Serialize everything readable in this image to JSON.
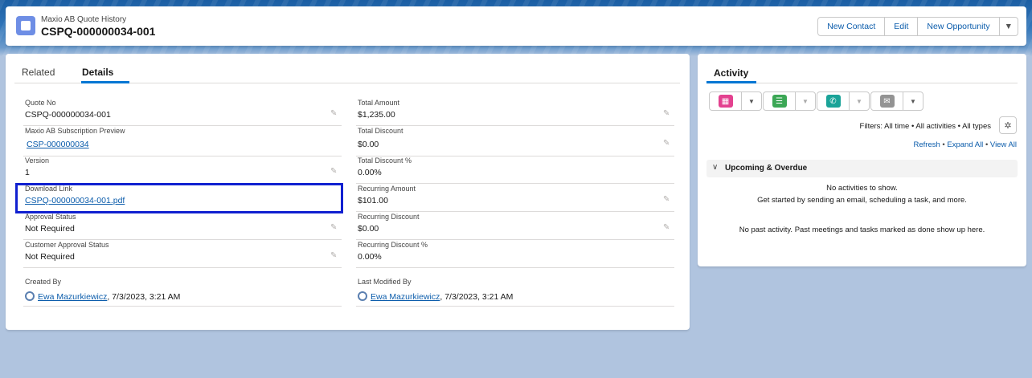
{
  "header": {
    "object_type": "Maxio AB Quote History",
    "record_title": "CSPQ-000000034-001",
    "buttons": [
      "New Contact",
      "Edit",
      "New Opportunity"
    ]
  },
  "tabs": [
    "Related",
    "Details"
  ],
  "details": {
    "left": [
      {
        "label": "Quote No",
        "value": "CSPQ-000000034-001"
      },
      {
        "label": "Maxio AB Subscription Preview",
        "value": "CSP-000000034"
      },
      {
        "label": "Version",
        "value": "1"
      },
      {
        "label": "Download Link",
        "value": "CSPQ-000000034-001.pdf"
      },
      {
        "label": "Approval Status",
        "value": "Not Required"
      },
      {
        "label": "Customer Approval Status",
        "value": "Not Required"
      }
    ],
    "right": [
      {
        "label": "Total Amount",
        "value": "$1,235.00"
      },
      {
        "label": "Total Discount",
        "value": "$0.00"
      },
      {
        "label": "Total Discount %",
        "value": "0.00%"
      },
      {
        "label": "Recurring Amount",
        "value": "$101.00"
      },
      {
        "label": "Recurring Discount",
        "value": "$0.00"
      },
      {
        "label": "Recurring Discount %",
        "value": "0.00%"
      }
    ],
    "created_by": {
      "label": "Created By",
      "user": "Ewa Mazurkiewicz",
      "date": ", 7/3/2023, 3:21 AM"
    },
    "last_modified_by": {
      "label": "Last Modified By",
      "user": "Ewa Mazurkiewicz",
      "date": ", 7/3/2023, 3:21 AM"
    }
  },
  "activity": {
    "tab": "Activity",
    "filters": "Filters: All time • All activities • All types",
    "links": {
      "refresh": "Refresh",
      "expand": "Expand All",
      "view": "View All"
    },
    "section_title": "Upcoming & Overdue",
    "empty_line1": "No activities to show.",
    "empty_line2": "Get started by sending an email, scheduling a task, and more.",
    "past_activity": "No past activity. Past meetings and tasks marked as done show up here."
  },
  "colors": {
    "brand": "#0176d3",
    "link": "#0b5cab",
    "highlight": "#1020d0",
    "event": "#e3418f",
    "task": "#3ba755",
    "call": "#1aa398",
    "email": "#939393"
  }
}
